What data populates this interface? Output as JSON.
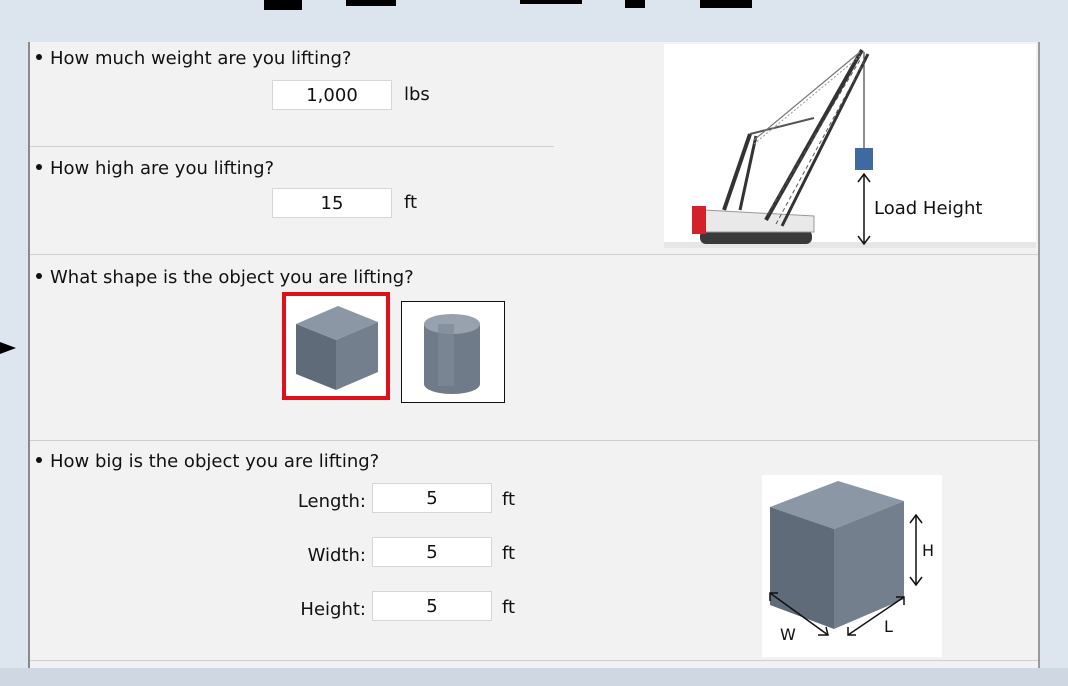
{
  "questions": {
    "weight": {
      "label": "How much weight are you lifting?",
      "value": "1,000",
      "unit": "lbs"
    },
    "height": {
      "label": "How high are you lifting?",
      "value": "15",
      "unit": "ft"
    },
    "shape": {
      "label": "What shape is the object you are lifting?",
      "options": [
        "cube-icon",
        "cylinder-icon"
      ],
      "selected": "cube"
    },
    "size": {
      "label": "How big is the object you are lifting?",
      "length": {
        "label": "Length:",
        "value": "5",
        "unit": "ft"
      },
      "width": {
        "label": "Width:",
        "value": "5",
        "unit": "ft"
      },
      "height": {
        "label": "Height:",
        "value": "5",
        "unit": "ft"
      }
    }
  },
  "crane_illustration": {
    "caption": "Load Height"
  },
  "dimension_diagram": {
    "h_label": "H",
    "w_label": "W",
    "l_label": "L"
  },
  "colors": {
    "selection_border": "#e0101b",
    "load_block": "#3e6aa1",
    "crane_red": "#d3222a",
    "shape_gray": "#6f7d8c"
  }
}
